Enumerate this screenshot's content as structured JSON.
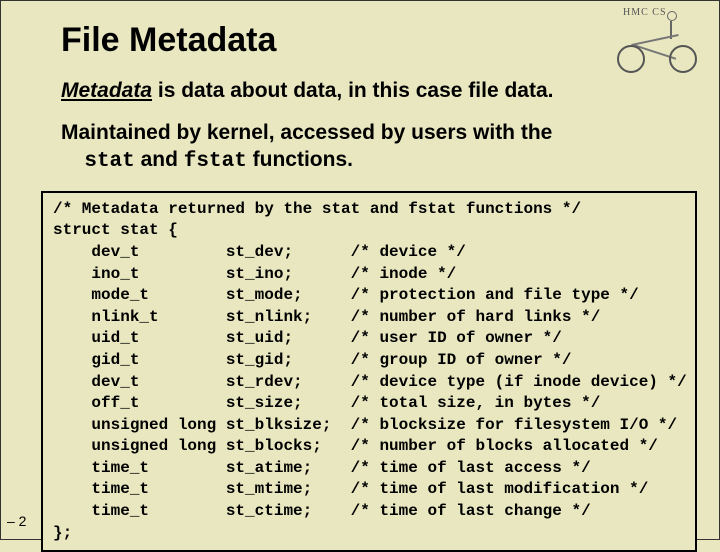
{
  "title": "File Metadata",
  "logo_label": "HMC CS",
  "subtitle1_prefix": "Metadata",
  "subtitle1_rest": " is data about data, in this case file data.",
  "subtitle2_line1": "Maintained by kernel, accessed by users with the",
  "subtitle2_indent": "stat",
  "subtitle2_mid": " and ",
  "subtitle2_fn2": "fstat",
  "subtitle2_end": " functions.",
  "page_marker": "– 2",
  "code": "/* Metadata returned by the stat and fstat functions */\nstruct stat {\n    dev_t         st_dev;      /* device */\n    ino_t         st_ino;      /* inode */\n    mode_t        st_mode;     /* protection and file type */\n    nlink_t       st_nlink;    /* number of hard links */\n    uid_t         st_uid;      /* user ID of owner */\n    gid_t         st_gid;      /* group ID of owner */\n    dev_t         st_rdev;     /* device type (if inode device) */\n    off_t         st_size;     /* total size, in bytes */\n    unsigned long st_blksize;  /* blocksize for filesystem I/O */\n    unsigned long st_blocks;   /* number of blocks allocated */\n    time_t        st_atime;    /* time of last access */\n    time_t        st_mtime;    /* time of last modification */\n    time_t        st_ctime;    /* time of last change */\n};"
}
